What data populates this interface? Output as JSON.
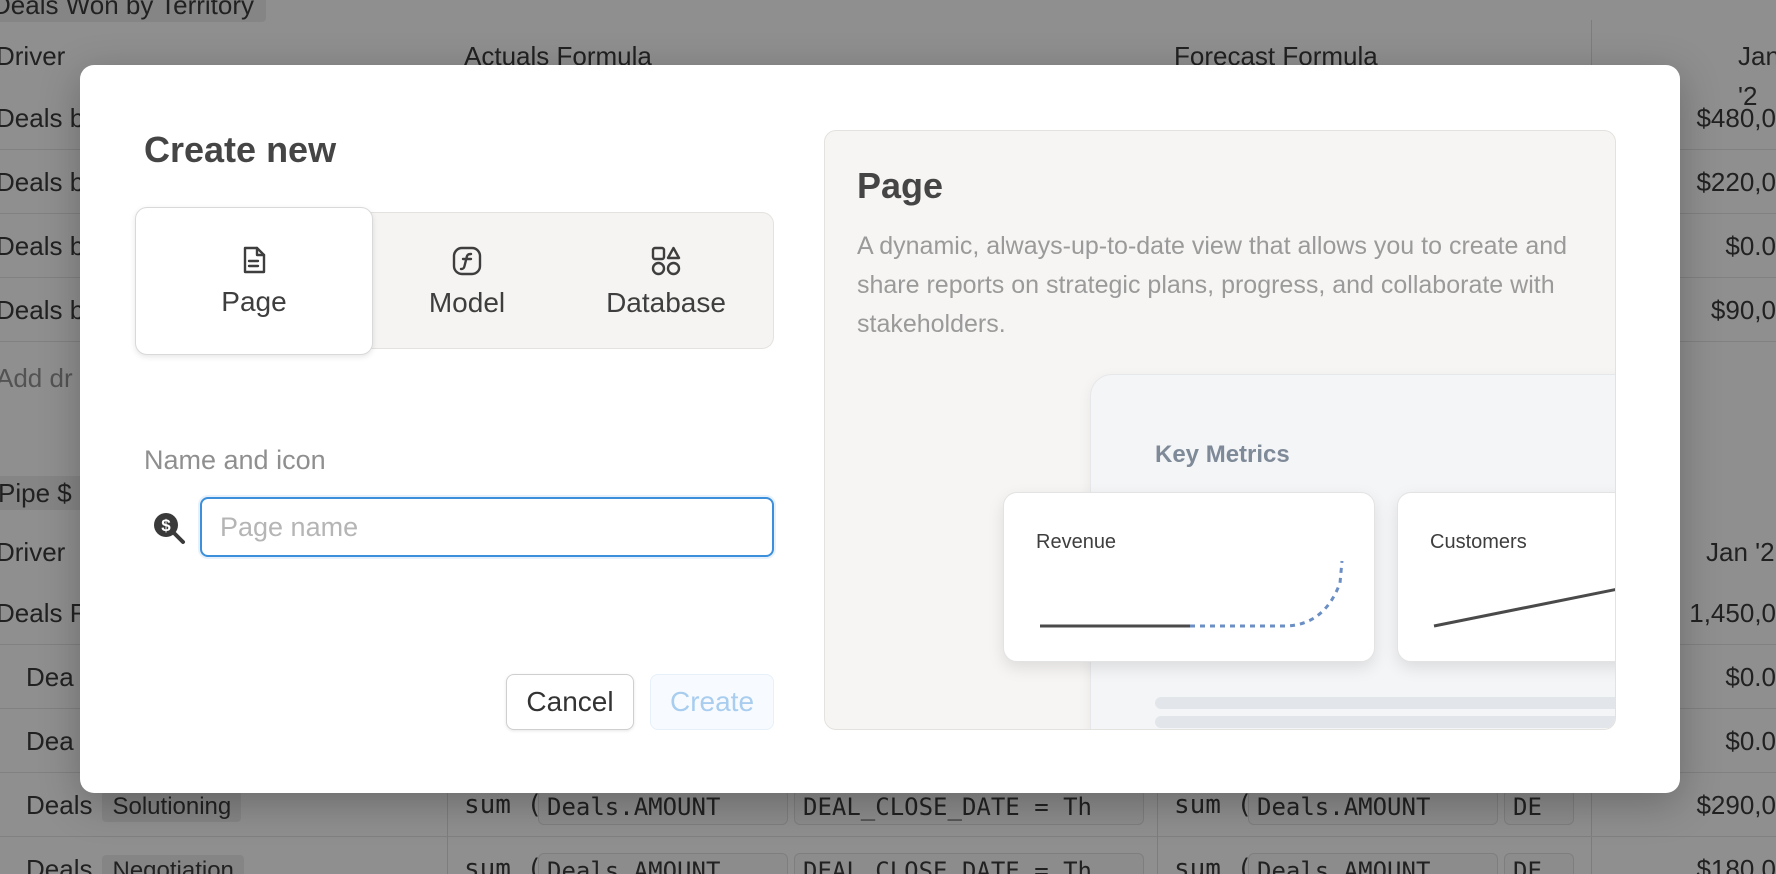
{
  "background": {
    "section1_title": "Deals Won by Territory",
    "header1": {
      "driver": "Driver",
      "actuals": "Actuals Formula",
      "forecast": "Forecast Formula",
      "month": "Jan '2"
    },
    "rows1": [
      {
        "driver": "Deals b",
        "value": "$480,0"
      },
      {
        "driver": "Deals b",
        "value": "$220,0"
      },
      {
        "driver": "Deals b",
        "value": "$0.0"
      },
      {
        "driver": "Deals b",
        "value": "$90,0"
      }
    ],
    "add_driver": "Add dr",
    "section2_title": "Pipe $",
    "header2": {
      "driver": "Driver",
      "month": "Jan '2"
    },
    "rows2": [
      {
        "driver": "Deals R",
        "value": "1,450,0"
      },
      {
        "driver": "Dea",
        "value": "$0.0"
      },
      {
        "driver": "Dea",
        "value": "$0.0"
      },
      {
        "driver": "Deals",
        "stage": "Solutioning",
        "sum": "sum (",
        "field": "Deals.AMOUNT",
        "filter": "DEAL_CLOSE_DATE = Th",
        "filter_short": "DE",
        "value": "$290,0"
      },
      {
        "driver": "Deals",
        "stage": "Negotiation",
        "sum": "sum (",
        "field": "Deals.AMOUNT",
        "filter": "DEAL_CLOSE_DATE = Th",
        "filter_short": "DE",
        "value": "$180,0"
      }
    ]
  },
  "modal": {
    "title": "Create new",
    "options": [
      {
        "label": "Page",
        "icon": "page-icon",
        "selected": true
      },
      {
        "label": "Model",
        "icon": "function-icon",
        "selected": false
      },
      {
        "label": "Database",
        "icon": "shapes-icon",
        "selected": false
      }
    ],
    "name_label": "Name and icon",
    "name_icon": "dollar-search-icon",
    "name_input": {
      "value": "",
      "placeholder": "Page name"
    },
    "cancel_label": "Cancel",
    "create_label": "Create",
    "preview": {
      "title": "Page",
      "description": "A dynamic, always-up-to-date view that allows you to create and share reports on strategic plans, progress, and collaborate with stakeholders.",
      "mock_title": "Key Metrics",
      "cards": [
        {
          "title": "Revenue"
        },
        {
          "title": "Customers"
        }
      ]
    }
  },
  "colors": {
    "accent_blue": "#3b8fdb",
    "overlay": "rgba(20,20,20,0.48)",
    "chart_dotted": "#6b8fc4"
  }
}
